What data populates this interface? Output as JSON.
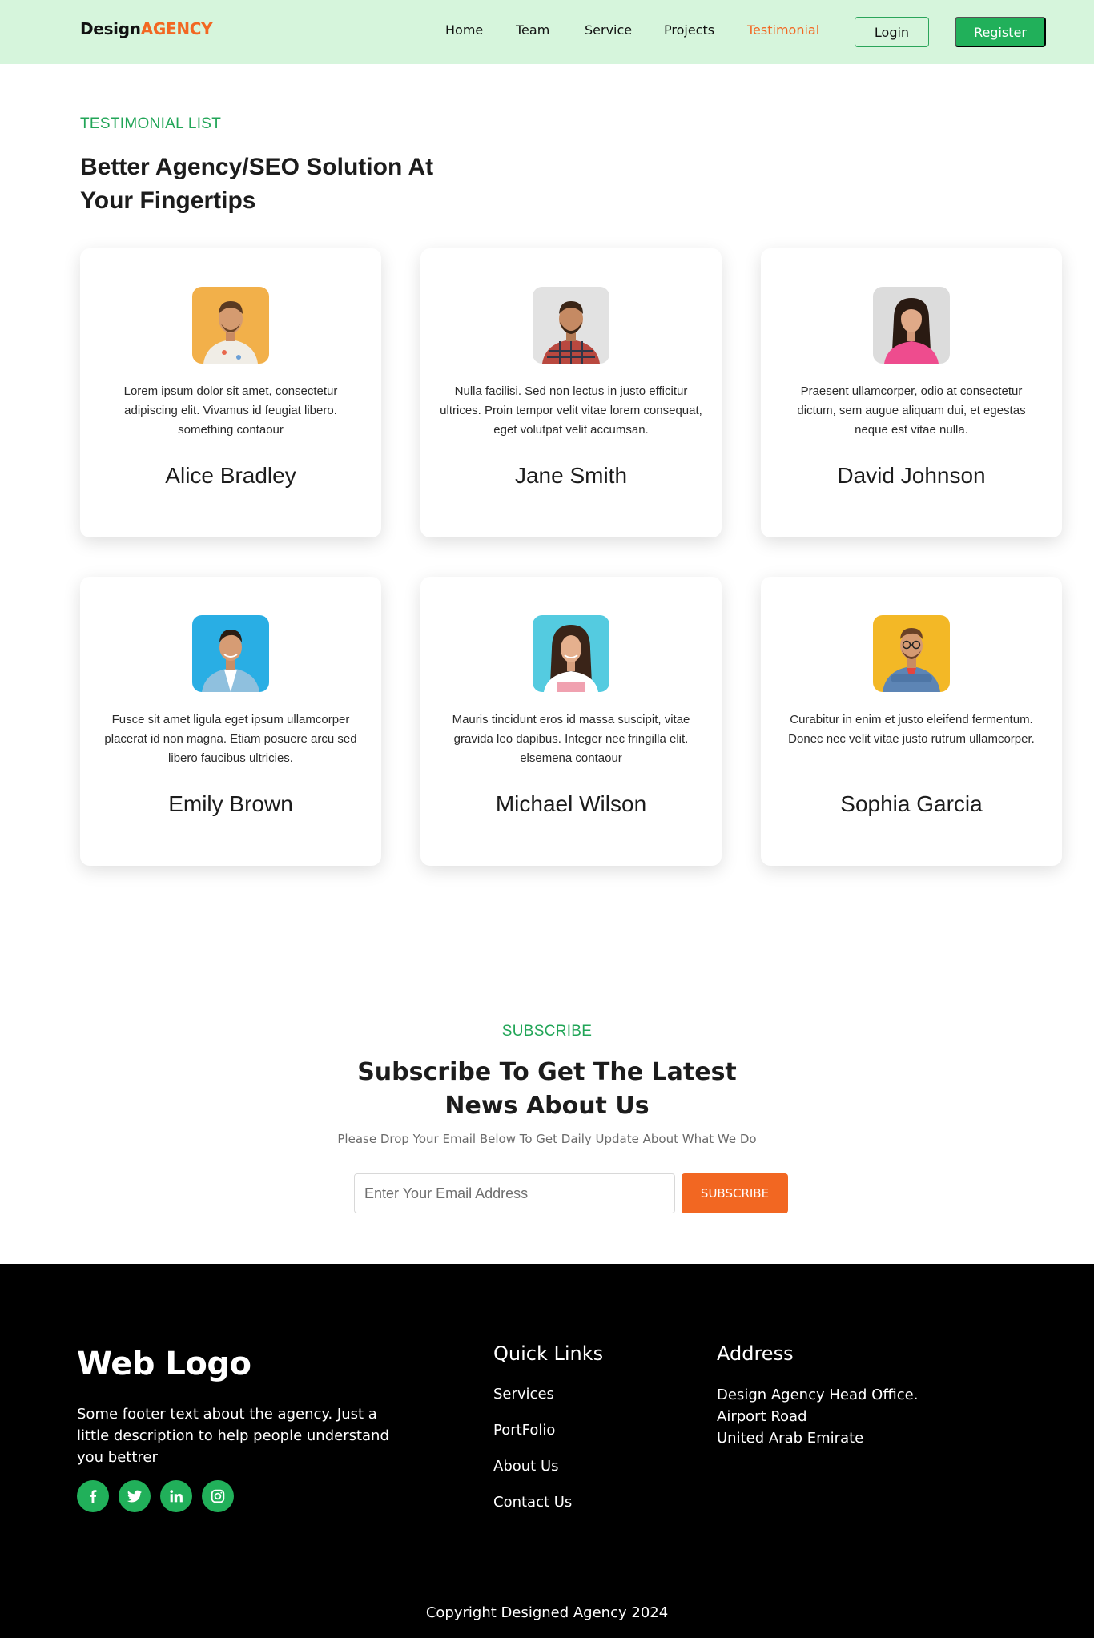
{
  "navbar": {
    "brand_prefix": "Design",
    "brand_accent": "AGENCY",
    "links": [
      {
        "label": "Home"
      },
      {
        "label": "Team"
      },
      {
        "label": "Service"
      },
      {
        "label": "Projects"
      },
      {
        "label": "Testimonial",
        "active": true
      }
    ],
    "login_label": "Login",
    "register_label": "Register"
  },
  "testimonials": {
    "eyebrow": "TESTIMONIAL LIST",
    "title": "Better Agency/SEO Solution At Your Fingertips",
    "cards": [
      {
        "name": "Alice Bradley",
        "text": "Lorem ipsum dolor sit amet, consectetur adipiscing elit. Vivamus id feugiat libero. something contaour",
        "avatar_bg": "#f2b04a"
      },
      {
        "name": "Jane Smith",
        "text": "Nulla facilisi. Sed non lectus in justo efficitur ultrices. Proin tempor velit vitae lorem consequat, eget volutpat velit accumsan.",
        "avatar_bg": "#e2e2e2"
      },
      {
        "name": "David Johnson",
        "text": "Praesent ullamcorper, odio at consectetur dictum, sem augue aliquam dui, et egestas neque est vitae nulla.",
        "avatar_bg": "#dcdcdc"
      },
      {
        "name": "Emily Brown",
        "text": "Fusce sit amet ligula eget ipsum ullamcorper placerat id non magna. Etiam posuere arcu sed libero faucibus ultricies.",
        "avatar_bg": "#29aee4"
      },
      {
        "name": "Michael Wilson",
        "text": "Mauris tincidunt eros id massa suscipit, vitae gravida leo dapibus. Integer nec fringilla elit. elsemena contaour",
        "avatar_bg": "#54cbe0"
      },
      {
        "name": "Sophia Garcia",
        "text": "Curabitur in enim et justo eleifend fermentum. Donec nec velit vitae justo rutrum ullamcorper.",
        "avatar_bg": "#f3b826"
      }
    ]
  },
  "subscribe": {
    "eyebrow": "SUBSCRIBE",
    "title": "Subscribe To Get The Latest News About Us",
    "description": "Please Drop Your Email Below To Get Daily Update About What We Do",
    "input_placeholder": "Enter Your Email Address",
    "button_label": "SUBSCRIBE"
  },
  "footer": {
    "logo": "Web Logo",
    "about": "Some footer text about the agency. Just a little description to help people understand you bettrer",
    "socials": [
      "facebook-icon",
      "twitter-icon",
      "linkedin-icon",
      "instagram-icon"
    ],
    "quick_links_title": "Quick Links",
    "quick_links": [
      "Services",
      "PortFolio",
      "About Us",
      "Contact Us"
    ],
    "address_title": "Address",
    "address_lines": [
      "Design Agency Head Office.",
      "Airport Road",
      "United Arab Emirate"
    ],
    "copyright": "Copyright Designed Agency 2024"
  },
  "colors": {
    "accent_green": "#21b05a",
    "accent_orange": "#f26722",
    "nav_bg": "#d6f5dc"
  }
}
